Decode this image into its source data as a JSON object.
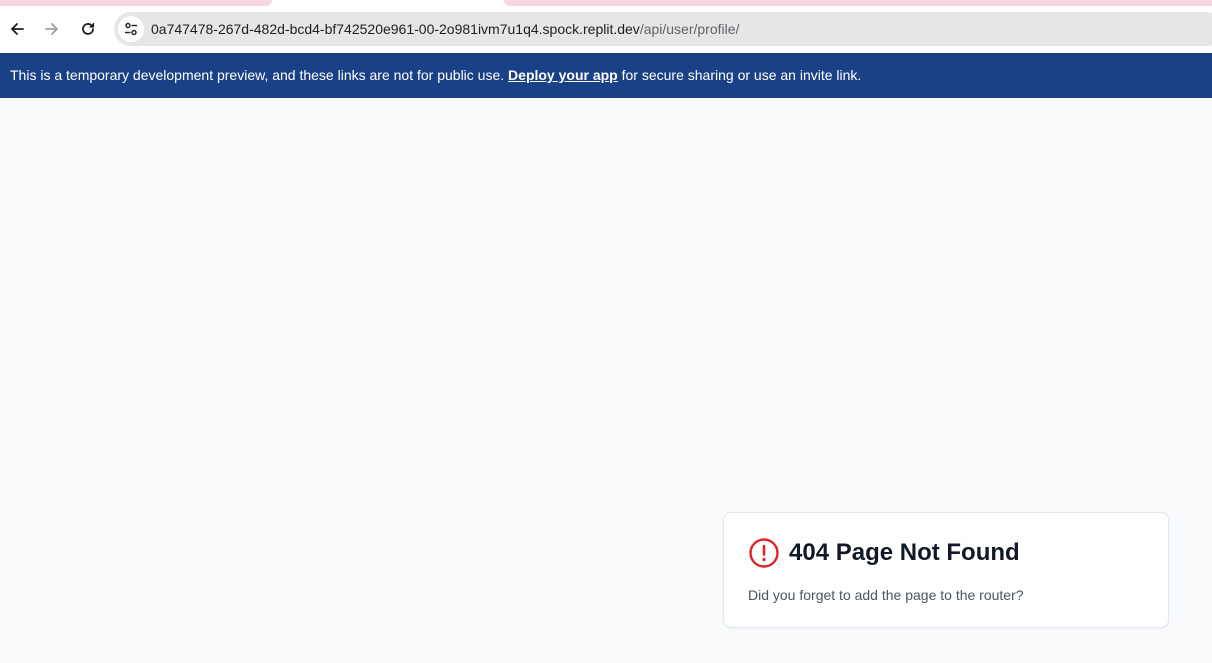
{
  "browser": {
    "back_icon": "arrow-left-icon",
    "forward_icon": "arrow-right-icon",
    "reload_icon": "reload-icon",
    "site_info_icon": "tune-icon",
    "url": {
      "host": "0a747478-267d-482d-bcd4-bf742520e961-00-2o981ivm7u1q4.spock.replit.dev",
      "path": "/api/user/profile/"
    }
  },
  "banner": {
    "text_before": "This is a temporary development preview, and these links are not for public use.",
    "link_label": "Deploy your app",
    "text_after": "for secure sharing or use an invite link.",
    "background": "#1a4185"
  },
  "error_card": {
    "icon": "alert-circle-icon",
    "icon_color": "#dc2626",
    "title": "404 Page Not Found",
    "message": "Did you forget to add the page to the router?"
  }
}
